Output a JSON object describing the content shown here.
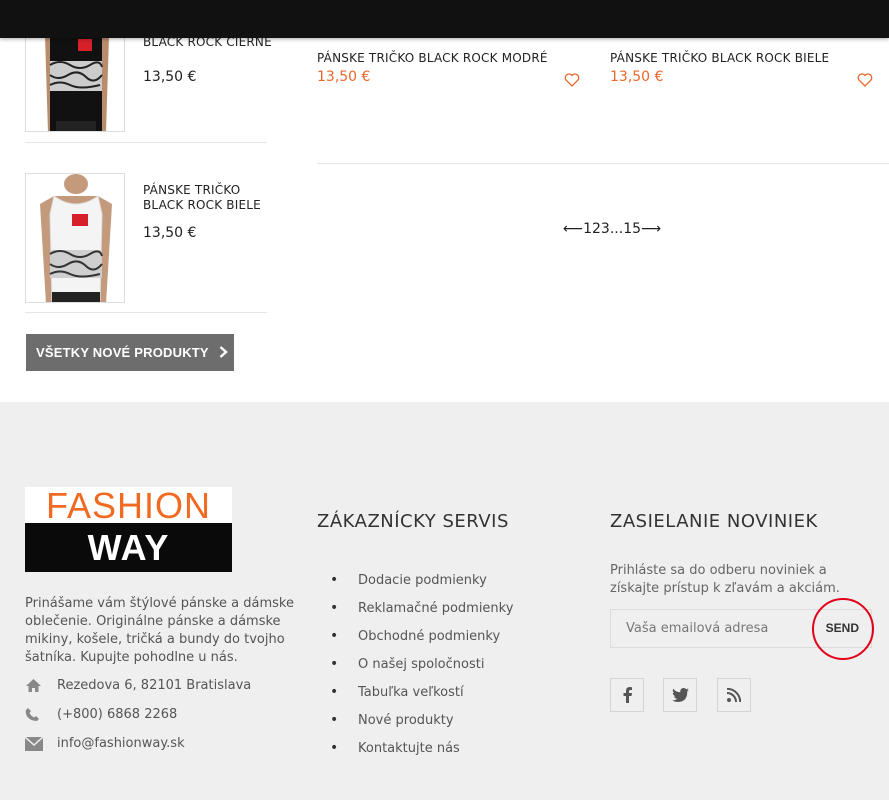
{
  "side_products": [
    {
      "name": "BLACK ROCK ČIERNE",
      "price": "13,50 €"
    },
    {
      "name": "PÁNSKE TRIČKO BLACK ROCK BIELE",
      "price": "13,50 €"
    }
  ],
  "all_products_button": "VŠETKY NOVÉ PRODUKTY",
  "grid_products": [
    {
      "name": "PÁNSKE TRIČKO BLACK ROCK MODRÉ",
      "price": "13,50 €"
    },
    {
      "name": "PÁNSKE TRIČKO BLACK ROCK BIELE",
      "price": "13,50 €"
    }
  ],
  "pagination": {
    "prev": "⟵",
    "pages": [
      "1",
      "2",
      "3",
      "...",
      "15"
    ],
    "next": "⟶"
  },
  "footer": {
    "logo_top": "FASHION",
    "logo_bottom": "WAY",
    "about": "Prinášame vám štýlové pánske a dámske oblečenie. Originálne pánske a dámske mikiny, košele, tričká a bundy do tvojho šatníka. Kupujte pohodlne u nás.",
    "address": "Rezedova 6, 82101 Bratislava",
    "phone": "(+800) 6868 2268",
    "email": "info@fashionway.sk",
    "service_title": "ZÁKAZNÍCKY SERVIS",
    "service_links": [
      "Dodacie podmienky",
      "Reklamačné podmienky",
      "Obchodné podmienky",
      "O našej spoločnosti",
      "Tabuľka veľkostí",
      "Nové produkty",
      "Kontaktujte nás"
    ],
    "newsletter_title": "ZASIELANIE NOVINIEK",
    "newsletter_text": "Prihláste sa do odberu noviniek a získajte prístup k zľavám a akciám.",
    "email_placeholder": "Vaša emailová adresa",
    "send_label": "SEND",
    "social_icons": [
      "facebook-icon",
      "twitter-icon",
      "rss-icon"
    ]
  },
  "colors": {
    "accent": "#e8672b",
    "highlight_circle": "#e2001a",
    "button_bg": "#6d6d6d"
  }
}
